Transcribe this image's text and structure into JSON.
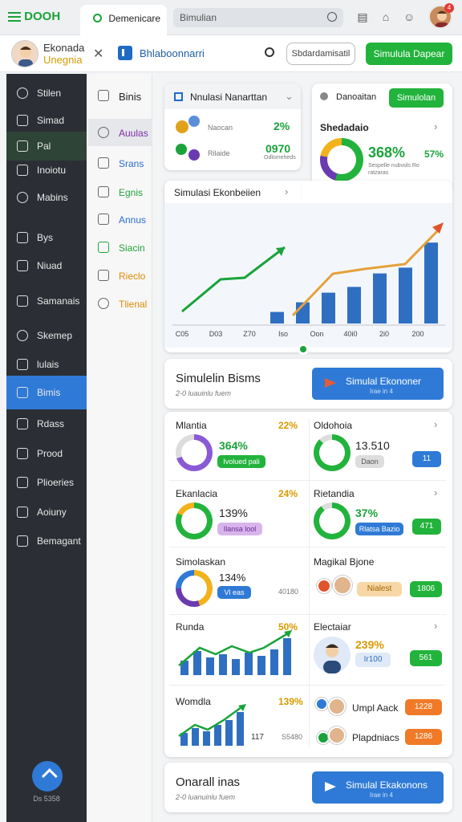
{
  "topbar": {
    "logo": "DOOH",
    "active_tab": "Demenicare",
    "search_value": "Bimulian",
    "notification_count": "4"
  },
  "subbar": {
    "name_line1": "Ekonada",
    "name_line2": "Unegnia",
    "app_title": "Bhlaboonnarri",
    "outline_button": "Sbdardamisatil",
    "green_button": "Simulula Dapear"
  },
  "sidebar": {
    "items": [
      "Stilen",
      "Simad",
      "Pal",
      "Inoiotu",
      "Mabins",
      "Bys",
      "Niuad",
      "Samanais",
      "Skemep",
      "lulais",
      "Bimis",
      "Rdass",
      "Prood",
      "Plioeries",
      "Aoiuny",
      "Bemagant"
    ],
    "footer": "Ds 5358"
  },
  "subnav": {
    "items": [
      {
        "label": "Binis",
        "color": "#222"
      },
      {
        "label": "Auulas",
        "color": "#7b2fa6"
      },
      {
        "label": "Srans",
        "color": "#2a6ed1"
      },
      {
        "label": "Egnis",
        "color": "#22a33a"
      },
      {
        "label": "Annus",
        "color": "#2a6ed1"
      },
      {
        "label": "Siacin",
        "color": "#22a33a"
      },
      {
        "label": "Rieclo",
        "color": "#e08a00"
      },
      {
        "label": "Tlienal",
        "color": "#e08a00"
      }
    ]
  },
  "card1": {
    "title": "Nnulasi Nanarttan",
    "row1_label": "Naocan",
    "row1_value": "2%",
    "row2_label": "Rilaide",
    "row2_value": "0970",
    "row2_sub": "Odlomeheds"
  },
  "card2": {
    "label": "Danoaitan",
    "button": "Simulolan",
    "title": "Shedadaio",
    "big_value": "368%",
    "side_value": "57%",
    "desc": "Sespelle nubvols Ro ratzaras"
  },
  "chart": {
    "title": "Simulasi Ekonbeiien",
    "x_labels": [
      "C05",
      "D03",
      "Z70",
      "Iso",
      "Oon",
      "40i0",
      "2i0",
      "200"
    ]
  },
  "chart_data": {
    "type": "bar",
    "title": "Simulasi Ekonbeiien",
    "categories": [
      "C05",
      "D03",
      "Z70",
      "Iso",
      "Oon",
      "40i0",
      "2i0",
      "200"
    ],
    "series": [
      {
        "values": [
          0,
          0,
          0,
          12,
          22,
          32,
          38,
          52,
          58,
          84
        ]
      }
    ],
    "ylim": [
      0,
      100
    ]
  },
  "banner1": {
    "title": "Simulelin Bisms",
    "sub": "2-0 luauinlu fuem",
    "button": "Simulal Ekononer",
    "button_sub": "Irae in 4"
  },
  "grid": {
    "c1": {
      "title": "Mlantia",
      "pct": "22%",
      "value": "364%",
      "pill": "Ivolued pali"
    },
    "c2": {
      "title": "Oldohoia",
      "value": "13.510",
      "pill": "Daon",
      "badge": "11"
    },
    "c3": {
      "title": "Ekanlacia",
      "pct": "24%",
      "value": "139%",
      "pill": "Ilansa lool"
    },
    "c4": {
      "title": "Rietandia",
      "value": "37%",
      "pill": "Rlatsa Bazio",
      "badge": "471"
    },
    "c5": {
      "title": "Simolaskan",
      "value": "134%",
      "pill": "Vl eas",
      "side": "40180"
    },
    "c6": {
      "title": "Magikal Bjone",
      "pill": "Nialest",
      "badge": "1806"
    },
    "c7": {
      "title": "Runda",
      "pct": "50%"
    },
    "c8": {
      "title": "Electaiar",
      "value": "239%",
      "pill": "Ir100",
      "badge": "561"
    },
    "c9": {
      "title": "Womdla",
      "pct": "139%",
      "v1": "117",
      "v2": "S5480"
    },
    "c10": {
      "row1": "Umpl Aack",
      "badge1": "1228",
      "row2": "Plapdniacs",
      "badge2": "1286"
    }
  },
  "banner2": {
    "title": "Onarall inas",
    "sub": "2-0 luanuinlu fuem",
    "button": "Simulal Ekakonons",
    "button_sub": "Irae in 4"
  }
}
